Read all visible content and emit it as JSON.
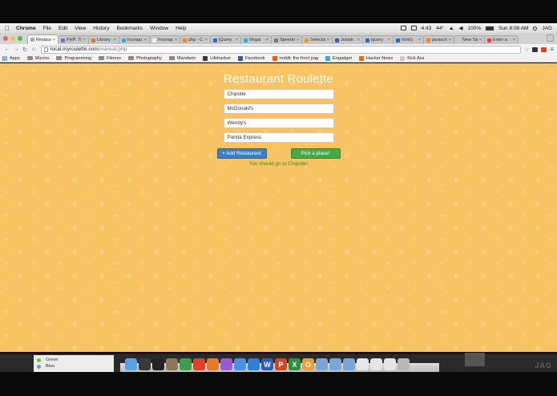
{
  "menubar": {
    "app_name": "Chrome",
    "items": [
      "File",
      "Edit",
      "View",
      "History",
      "Bookmarks",
      "Window",
      "Help"
    ],
    "status": {
      "clock": "4:43",
      "temperature": "44°",
      "battery": "100%",
      "datetime": "Sun 8:08 AM",
      "user": "JAG"
    }
  },
  "tabs": [
    {
      "label": "Restaur",
      "active": true,
      "color": "#aaaaaa"
    },
    {
      "label": "PHP: Ti",
      "active": false,
      "color": "#7b6cc2"
    },
    {
      "label": "Library",
      "active": false,
      "color": "#e0762a"
    },
    {
      "label": "foursqu",
      "active": false,
      "color": "#3aa9dc"
    },
    {
      "label": "Foursqu",
      "active": false,
      "color": "#f0f0f0"
    },
    {
      "label": "php - C",
      "active": false,
      "color": "#f47f24"
    },
    {
      "label": "jQuery",
      "active": false,
      "color": "#2c6cb0"
    },
    {
      "label": "Illegal",
      "active": false,
      "color": "#3aa9dc"
    },
    {
      "label": "Speedo",
      "active": false,
      "color": "#777777"
    },
    {
      "label": "Selectab",
      "active": false,
      "color": "#e89a2a"
    },
    {
      "label": "Josiah",
      "active": false,
      "color": "#3b5998"
    },
    {
      "label": "jquery",
      "active": false,
      "color": "#2c6cb0"
    },
    {
      "label": "html()",
      "active": false,
      "color": "#2c6cb0"
    },
    {
      "label": "javascri",
      "active": false,
      "color": "#f47f24"
    },
    {
      "label": "New Tab",
      "active": false,
      "color": "#cccccc"
    },
    {
      "label": "Enter a",
      "active": false,
      "color": "#e2402b"
    }
  ],
  "address": {
    "host": "local.myroulette.com",
    "path": "/manual.php"
  },
  "bookmarks": [
    {
      "label": "Apps",
      "type": "grid"
    },
    {
      "label": "Mizzou",
      "type": "folder"
    },
    {
      "label": "Programming",
      "type": "folder"
    },
    {
      "label": "Fitness",
      "type": "folder"
    },
    {
      "label": "Photography",
      "type": "folder"
    },
    {
      "label": "Mandarin",
      "type": "folder"
    },
    {
      "label": "Lifehacker",
      "type": "fav",
      "color": "#3a3a3a"
    },
    {
      "label": "Facebook",
      "type": "fav",
      "color": "#3b5998"
    },
    {
      "label": "reddit: the front pag",
      "type": "fav",
      "color": "#ff5700"
    },
    {
      "label": "Engadget",
      "type": "fav",
      "color": "#3aa9dc"
    },
    {
      "label": "Hacker News",
      "type": "fav",
      "color": "#ff6600"
    },
    {
      "label": "Kick Ass",
      "type": "fav",
      "color": "#cccccc"
    }
  ],
  "app": {
    "title": "Restaurant Roulette",
    "restaurants": [
      "Chipotle",
      "McDonald's",
      "Wendy's",
      "Panda Express"
    ],
    "add_button": "+ Add Restaurant",
    "pick_button": "Pick a place!",
    "result": "You should go to Chipotle!"
  },
  "legend": [
    {
      "label": "Green",
      "color": "#6cc04a"
    },
    {
      "label": "Blue",
      "color": "#5b9be3"
    }
  ],
  "dock_icons": [
    {
      "name": "finder",
      "color": "#5aa0e6",
      "glyph": ""
    },
    {
      "name": "activity-monitor",
      "color": "#3a3a3a",
      "glyph": ""
    },
    {
      "name": "terminal",
      "color": "#222222",
      "glyph": ""
    },
    {
      "name": "preview",
      "color": "#8a7a5a",
      "glyph": ""
    },
    {
      "name": "green-app",
      "color": "#3aa04a",
      "glyph": ""
    },
    {
      "name": "chrome",
      "color": "#e2402b",
      "glyph": ""
    },
    {
      "name": "firefox",
      "color": "#e77a23",
      "glyph": ""
    },
    {
      "name": "itunes",
      "color": "#9a5ad6",
      "glyph": ""
    },
    {
      "name": "safari",
      "color": "#4a90e2",
      "glyph": ""
    },
    {
      "name": "app-store",
      "color": "#2e7fd8",
      "glyph": ""
    },
    {
      "name": "word",
      "color": "#2b5fb3",
      "glyph": "W"
    },
    {
      "name": "powerpoint",
      "color": "#d24726",
      "glyph": "P"
    },
    {
      "name": "excel",
      "color": "#2f8f3a",
      "glyph": "X"
    },
    {
      "name": "outlook",
      "color": "#e8a13a",
      "glyph": "O"
    },
    {
      "name": "folder",
      "color": "#7aa6d6",
      "glyph": ""
    },
    {
      "name": "folder",
      "color": "#7aa6d6",
      "glyph": ""
    },
    {
      "name": "folder",
      "color": "#7aa6d6",
      "glyph": ""
    },
    {
      "name": "documents",
      "color": "#e6e6e6",
      "glyph": ""
    },
    {
      "name": "documents",
      "color": "#e6e6e6",
      "glyph": ""
    },
    {
      "name": "documents",
      "color": "#e6e6e6",
      "glyph": ""
    },
    {
      "name": "trash",
      "color": "#b8b8b8",
      "glyph": ""
    }
  ],
  "watermark": "JAG"
}
